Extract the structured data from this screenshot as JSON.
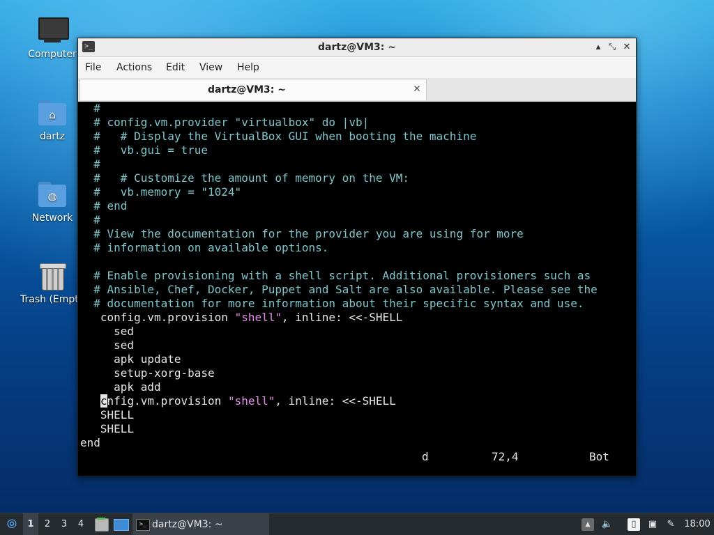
{
  "desktop_icons": [
    {
      "label": "Computer",
      "icon": "computer-icon"
    },
    {
      "label": "dartz",
      "icon": "home-folder-icon"
    },
    {
      "label": "Network",
      "icon": "network-folder-icon"
    },
    {
      "label": "Trash (Empty)",
      "icon": "trash-icon"
    }
  ],
  "window": {
    "title": "dartz@VM3: ~",
    "app_icon_glyph": ">_",
    "controls": {
      "minimize": "▴",
      "maximize": "⤡",
      "close": "✕"
    },
    "menu": [
      "File",
      "Actions",
      "Edit",
      "View",
      "Help"
    ],
    "tab": {
      "label": "dartz@VM3: ~",
      "close": "✕"
    }
  },
  "terminal": {
    "lines": [
      {
        "type": "comment",
        "text": "  #"
      },
      {
        "type": "comment",
        "text": "  # config.vm.provider \"virtualbox\" do |vb|"
      },
      {
        "type": "comment",
        "text": "  #   # Display the VirtualBox GUI when booting the machine"
      },
      {
        "type": "comment",
        "text": "  #   vb.gui = true"
      },
      {
        "type": "comment",
        "text": "  #"
      },
      {
        "type": "comment",
        "text": "  #   # Customize the amount of memory on the VM:"
      },
      {
        "type": "comment",
        "text": "  #   vb.memory = \"1024\""
      },
      {
        "type": "comment",
        "text": "  # end"
      },
      {
        "type": "comment",
        "text": "  #"
      },
      {
        "type": "comment",
        "text": "  # View the documentation for the provider you are using for more"
      },
      {
        "type": "comment",
        "text": "  # information on available options."
      },
      {
        "type": "blank",
        "text": ""
      },
      {
        "type": "comment",
        "text": "  # Enable provisioning with a shell script. Additional provisioners such as"
      },
      {
        "type": "comment",
        "text": "  # Ansible, Chef, Docker, Puppet and Salt are also available. Please see the"
      },
      {
        "type": "comment",
        "text": "  # documentation for more information about their specific syntax and use."
      },
      {
        "type": "code",
        "pre": "   config.vm.provision ",
        "str": "\"shell\"",
        "post": ", inline: <<-SHELL"
      },
      {
        "type": "code",
        "pre": "     sed",
        "str": "",
        "post": ""
      },
      {
        "type": "code",
        "pre": "     sed",
        "str": "",
        "post": ""
      },
      {
        "type": "code",
        "pre": "     apk update",
        "str": "",
        "post": ""
      },
      {
        "type": "code",
        "pre": "     setup-xorg-base",
        "str": "",
        "post": ""
      },
      {
        "type": "code",
        "pre": "     apk add",
        "str": "",
        "post": ""
      },
      {
        "type": "cursorline",
        "pre": "   ",
        "cursor": "c",
        "mid": "nfig.vm.provision ",
        "str": "\"shell\"",
        "post": ", inline: <<-SHELL"
      },
      {
        "type": "code",
        "pre": "   SHELL",
        "str": "",
        "post": ""
      },
      {
        "type": "code",
        "pre": "   SHELL",
        "str": "",
        "post": ""
      },
      {
        "type": "code",
        "pre": "end",
        "str": "",
        "post": ""
      }
    ],
    "status": {
      "command": "d",
      "position": "72,4",
      "scroll": "Bot"
    },
    "colors": {
      "comment": "#7ec6cb",
      "string": "#e38ae9",
      "text": "#e6e6e6",
      "background": "#000000"
    }
  },
  "taskbar": {
    "start_icon": "⦾",
    "workspaces": [
      "1",
      "2",
      "3",
      "4"
    ],
    "active_workspace": "1",
    "task": {
      "label": "dartz@VM3: ~",
      "icon_glyph": ">_"
    },
    "tray": {
      "up_arrow": "▲",
      "volume": "🔈",
      "clipboard": "▯",
      "network": "▣",
      "updates": "✎"
    },
    "clock": "18:00"
  }
}
